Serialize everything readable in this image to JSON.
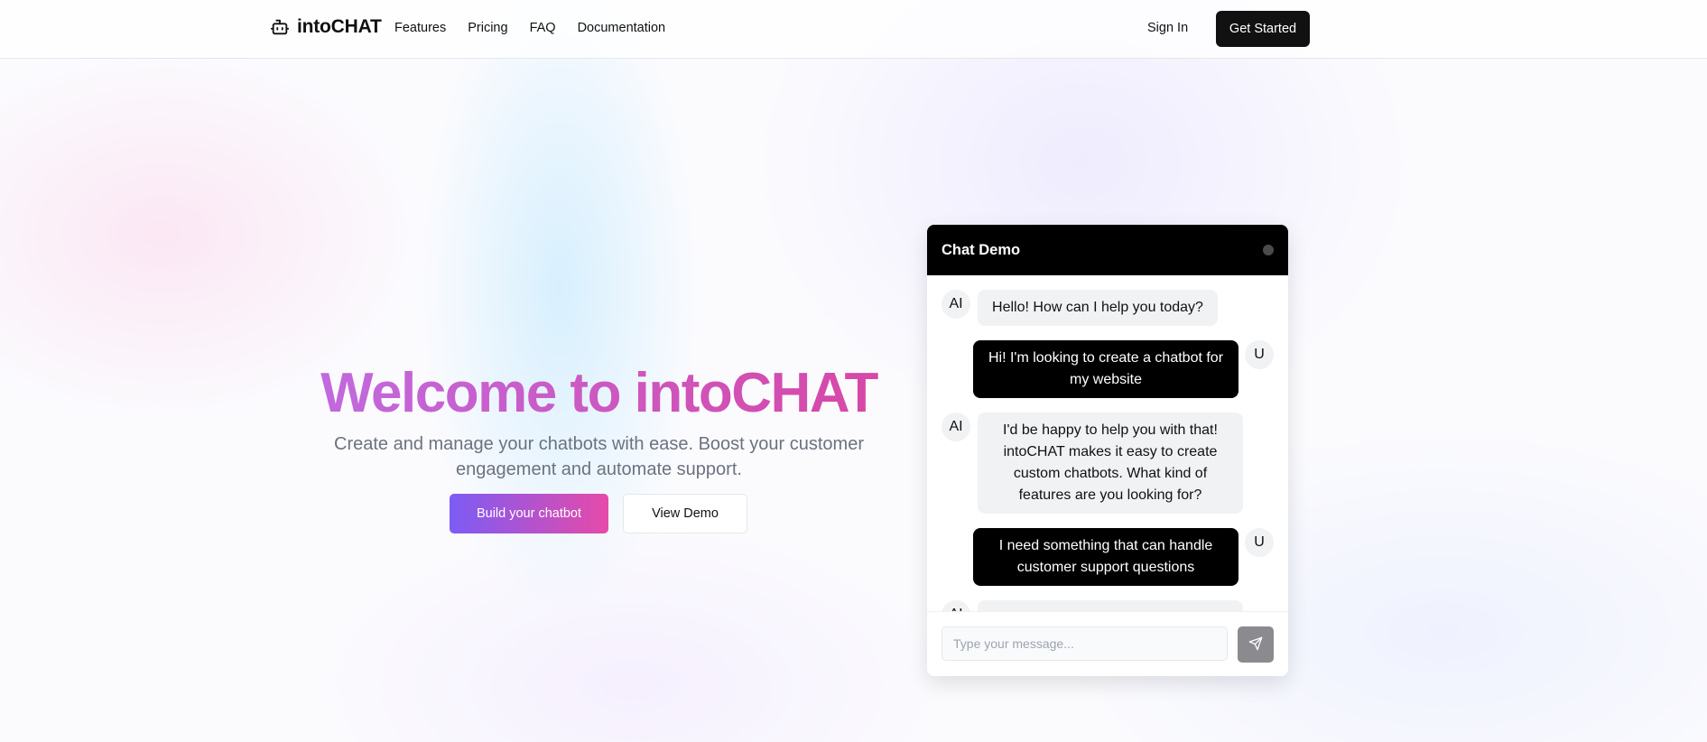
{
  "nav": {
    "brand": "intoCHAT",
    "brand_icon": "bot-icon",
    "links": [
      "Features",
      "Pricing",
      "FAQ",
      "Documentation"
    ],
    "sign_in": "Sign In",
    "get_started": "Get Started"
  },
  "hero": {
    "title": "Welcome to intoCHAT",
    "subtitle": "Create and manage your chatbots with ease. Boost your customer engagement and automate support.",
    "primary_button": "Build your chatbot",
    "secondary_button": "View Demo"
  },
  "chat": {
    "title": "Chat Demo",
    "messages": [
      {
        "role": "ai",
        "avatar": "AI",
        "text": "Hello! How can I help you today?"
      },
      {
        "role": "user",
        "avatar": "U",
        "text": "Hi! I'm looking to create a chatbot for my website"
      },
      {
        "role": "ai",
        "avatar": "AI",
        "text": "I'd be happy to help you with that! intoCHAT makes it easy to create custom chatbots. What kind of features are you looking for?"
      },
      {
        "role": "user",
        "avatar": "U",
        "text": "I need something that can handle customer support questions"
      },
      {
        "role": "ai",
        "avatar": "AI",
        "text": ""
      }
    ],
    "input_placeholder": "Type your message...",
    "send_icon": "send-icon"
  },
  "colors": {
    "title_gradient": [
      "#c06be0",
      "#d846a4"
    ],
    "primary_gradient": [
      "#7c5cf5",
      "#e64aa8"
    ],
    "dark": "#111111"
  }
}
